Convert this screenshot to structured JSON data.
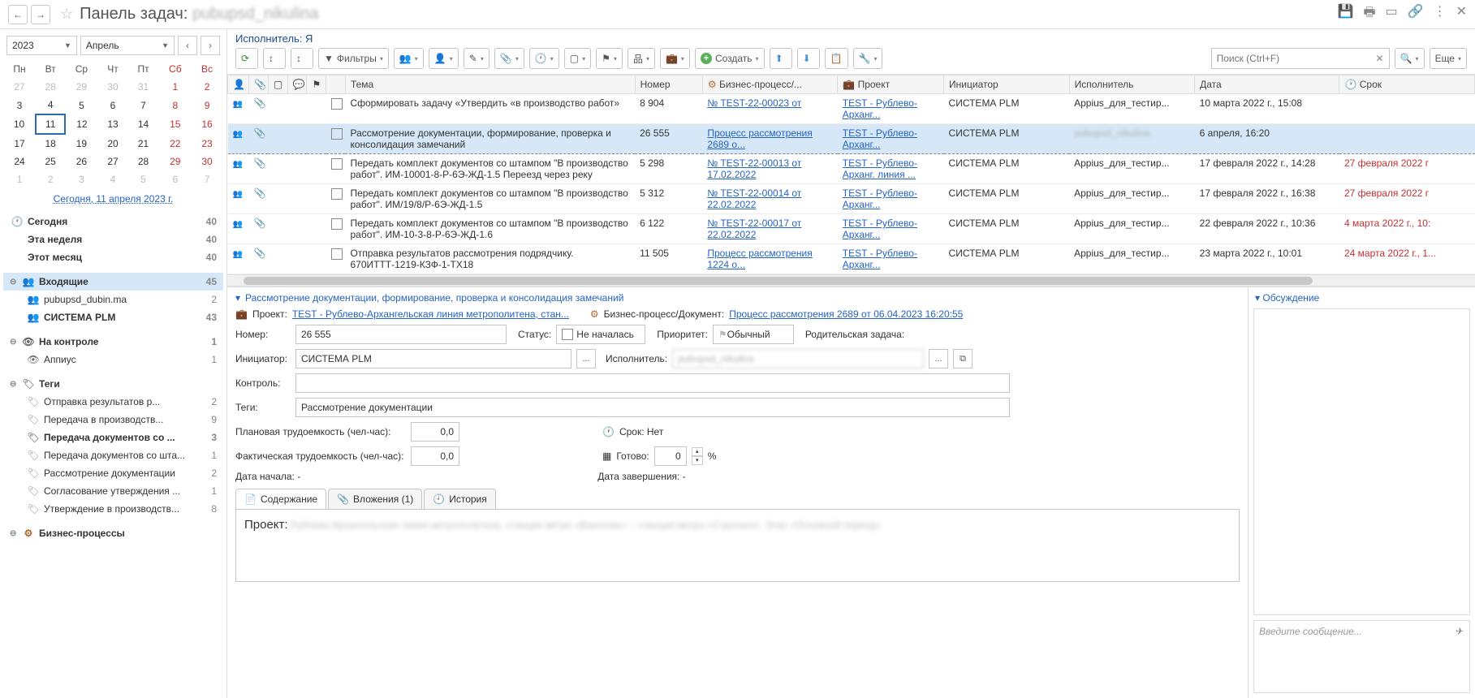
{
  "header": {
    "title_prefix": "Панель задач: ",
    "title_user": "pubupsd_nikulina"
  },
  "calendar": {
    "year": "2023",
    "month": "Апрель",
    "weekdays": [
      "Пн",
      "Вт",
      "Ср",
      "Чт",
      "Пт",
      "Сб",
      "Вс"
    ],
    "today_link": "Сегодня, 11 апреля 2023 г."
  },
  "side_quick": [
    {
      "label": "Сегодня",
      "count": "40"
    },
    {
      "label": "Эта неделя",
      "count": "40"
    },
    {
      "label": "Этот месяц",
      "count": "40"
    }
  ],
  "side_inbox": {
    "label": "Входящие",
    "count": "45"
  },
  "side_inbox_children": [
    {
      "label": "pubupsd_dubin.ma",
      "count": "2"
    },
    {
      "label": "СИСТЕМА PLM",
      "count": "43"
    }
  ],
  "side_control": {
    "label": "На контроле",
    "count": "1"
  },
  "side_control_children": [
    {
      "label": "Аппиус",
      "count": "1"
    }
  ],
  "side_tags_label": "Теги",
  "side_tags": [
    {
      "label": "Отправка результатов р...",
      "count": "2"
    },
    {
      "label": "Передача в производств...",
      "count": "9"
    },
    {
      "label": "Передача документов со ...",
      "count": "3"
    },
    {
      "label": "Передача документов со шта...",
      "count": "1"
    },
    {
      "label": "Рассмотрение документации",
      "count": "2"
    },
    {
      "label": "Согласование утверждения ...",
      "count": "1"
    },
    {
      "label": "Утверждение в производств...",
      "count": "8"
    }
  ],
  "side_bp_label": "Бизнес-процессы",
  "executor_label": "Исполнитель: Я",
  "toolbar": {
    "filters": "Фильтры",
    "create": "Создать",
    "more": "Еще",
    "search_placeholder": "Поиск (Ctrl+F)"
  },
  "table": {
    "headers": {
      "theme": "Тема",
      "number": "Номер",
      "bp": "Бизнес-процесс/...",
      "project": "Проект",
      "initiator": "Инициатор",
      "executor": "Исполнитель",
      "date": "Дата",
      "due": "Срок"
    },
    "rows": [
      {
        "theme": "Сформировать задачу «Утвердить «в производство работ»",
        "number": "8 904",
        "bp": "№ TEST-22-00023 от",
        "project": "TEST - Рублево-Арханг...",
        "initiator": "СИСТЕМА PLM",
        "executor": "Appius_для_тестир...",
        "date": "10 марта 2022 г., 15:08",
        "due": "",
        "overdue": false,
        "sel": false
      },
      {
        "theme": "Рассмотрение документации, формирование, проверка и консолидация замечаний",
        "number": "26 555",
        "bp": "Процесс рассмотрения 2689 о...",
        "project": "TEST - Рублево-Арханг...",
        "initiator": "СИСТЕМА PLM",
        "executor": "pubupsd_nikulina",
        "date": "6 апреля, 16:20",
        "due": "",
        "overdue": false,
        "sel": true,
        "exec_blur": true
      },
      {
        "theme": "Передать комплект документов со штампом \"В производство работ\". ИМ-10001-8-Р-6Э-ЖД-1.5 Переезд через реку",
        "number": "5 298",
        "bp": "№ TEST-22-00013 от 17.02.2022",
        "project": "TEST - Рублево-Арханг. линия ...",
        "initiator": "СИСТЕМА PLM",
        "executor": "Appius_для_тестир...",
        "date": "17 февраля 2022 г., 14:28",
        "due": "27 февраля 2022 г",
        "overdue": true,
        "sel": false
      },
      {
        "theme": "Передать комплект документов со штампом \"В производство работ\". ИМ/19/8/Р-6Э-ЖД-1.5",
        "number": "5 312",
        "bp": "№ TEST-22-00014 от 22.02.2022",
        "project": "TEST - Рублево-Арханг...",
        "initiator": "СИСТЕМА PLM",
        "executor": "Appius_для_тестир...",
        "date": "17 февраля 2022 г., 16:38",
        "due": "27 февраля 2022 г",
        "overdue": true,
        "sel": false
      },
      {
        "theme": "Передать комплект документов со штампом \"В производство работ\". ИМ-10-3-8-Р-6Э-ЖД-1.6",
        "number": "6 122",
        "bp": "№ TEST-22-00017 от 22.02.2022",
        "project": "TEST - Рублево-Арханг...",
        "initiator": "СИСТЕМА PLM",
        "executor": "Appius_для_тестир...",
        "date": "22 февраля 2022 г., 10:36",
        "due": "4 марта 2022 г., 10:",
        "overdue": true,
        "sel": false
      },
      {
        "theme": "Отправка результатов рассмотрения подрядчику. 670ИТТТ-1219-КЗФ-1-ТХ18",
        "number": "11 505",
        "bp": "Процесс рассмотрения 1224 о...",
        "project": "TEST - Рублево-Арханг...",
        "initiator": "СИСТЕМА PLM",
        "executor": "Appius_для_тестир...",
        "date": "23 марта 2022 г., 10:01",
        "due": "24 марта 2022 г., 1...",
        "overdue": true,
        "sel": false
      }
    ]
  },
  "detail": {
    "title": "Рассмотрение документации, формирование, проверка и консолидация замечаний",
    "project_label": "Проект:",
    "project_link": "TEST - Рублево-Архангельская линия метрополитена, стан...",
    "bp_label": "Бизнес-процесс/Документ:",
    "bp_link": "Процесс рассмотрения 2689 от 06.04.2023 16:20:55",
    "labels": {
      "number": "Номер:",
      "status": "Статус:",
      "priority": "Приоритет:",
      "parent": "Родительская задача:",
      "initiator": "Инициатор:",
      "executor": "Исполнитель:",
      "control": "Контроль:",
      "tags": "Теги:",
      "plan": "Плановая трудоемкость (чел-час):",
      "fact": "Фактическая трудоемкость (чел-час):",
      "due": "Срок: Нет",
      "ready": "Готово:",
      "start": "Дата начала: -",
      "end": "Дата завершения: -"
    },
    "number_val": "26 555",
    "status_val": "Не началась",
    "priority_val": "Обычный",
    "initiator_val": "СИСТЕМА PLM",
    "executor_val": "pubupsd_nikulina",
    "tags_val": "Рассмотрение документации",
    "plan_val": "0,0",
    "fact_val": "0,0",
    "ready_val": "0",
    "ready_suffix": "%",
    "tabs": {
      "content": "Содержание",
      "attach": "Вложения (1)",
      "history": "История"
    },
    "content_project_label": "Проект:",
    "discussion": "Обсуждение",
    "msg_placeholder": "Введите сообщение..."
  }
}
